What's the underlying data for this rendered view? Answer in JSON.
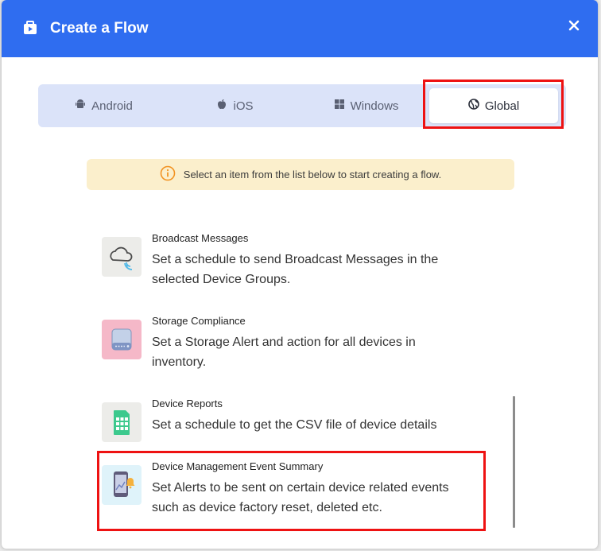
{
  "dialog": {
    "title": "Create a Flow",
    "close_label": "×"
  },
  "tabs": [
    {
      "label": "Android",
      "icon": "android-icon",
      "selected": false
    },
    {
      "label": "iOS",
      "icon": "apple-icon",
      "selected": false
    },
    {
      "label": "Windows",
      "icon": "windows-icon",
      "selected": false
    },
    {
      "label": "Global",
      "icon": "globe-icon",
      "selected": true
    }
  ],
  "info_banner": {
    "icon": "info-icon",
    "text": "Select an item from the list below to start creating a flow."
  },
  "flows": [
    {
      "title": "Broadcast Messages",
      "description": "Set a schedule to send Broadcast Messages in the selected Device Groups.",
      "icon": "cloud-broadcast-icon"
    },
    {
      "title": "Storage Compliance",
      "description": "Set a Storage Alert and action for all devices in inventory.",
      "icon": "storage-drive-icon"
    },
    {
      "title": "Device Reports",
      "description": "Set a schedule to get the CSV file of device details",
      "icon": "csv-report-icon"
    },
    {
      "title": "Device Management Event Summary",
      "description": "Set Alerts to be sent on certain device related events such as device factory reset, deleted etc.",
      "icon": "device-alert-icon"
    }
  ],
  "colors": {
    "header": "#2f6df0",
    "tab_bar": "#dbe3f9",
    "info_bg": "#fbefcc",
    "highlight": "#ee1212"
  }
}
